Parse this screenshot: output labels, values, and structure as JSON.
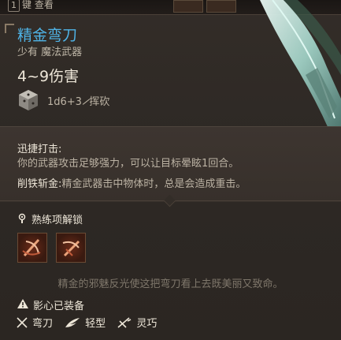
{
  "top_bar": {
    "key": "1",
    "hint_label": "键 查看"
  },
  "item": {
    "name": "精金弯刀",
    "rarity_type": "少有 魔法武器",
    "damage": "4~9伤害",
    "damage_dice": "1d6+3",
    "damage_type": "挥砍"
  },
  "passives": [
    {
      "name": "迅捷打击:",
      "description": "你的武器攻击足够强力，可以让目标晕眩1回合。"
    },
    {
      "name": "削铁斩金:",
      "description": "精金武器击中物体时，总是会造成重击。"
    }
  ],
  "mastery": {
    "title": "熟练项解锁"
  },
  "flavor_text": "精金的邪魅反光使这把弯刀看上去既美丽又致命。",
  "equipped": {
    "title": "影心已装备"
  },
  "properties": [
    "弯刀",
    "轻型",
    "灵巧"
  ],
  "colors": {
    "item_name": "#4fb3e6",
    "background": "#2e2925",
    "text": "#ede6d8",
    "muted": "#7f776b"
  },
  "icons": [
    "dice-icon",
    "slash-icon",
    "mastery-lock-icon",
    "warning-icon",
    "scimitar-icon",
    "feather-icon",
    "finesse-icon",
    "weapon-blade-icon"
  ]
}
